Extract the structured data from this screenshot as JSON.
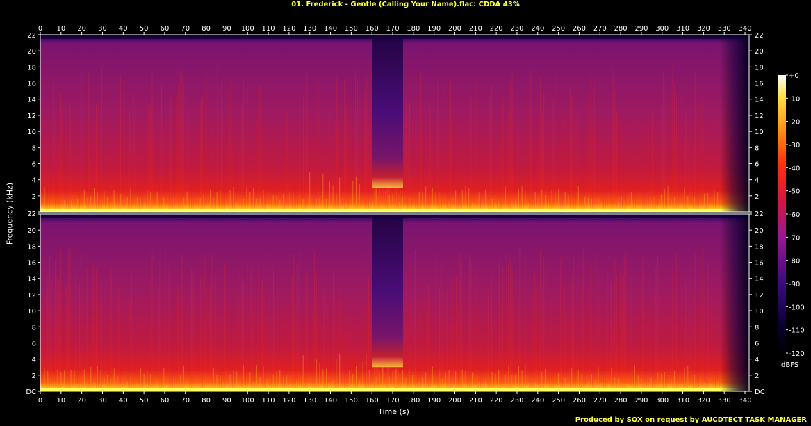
{
  "title": "01. Frederick - Gentle (Calling Your Name).flac: CDDA 43%",
  "footer": "Produced by SOX on request by AUCDTECT TASK MANAGER",
  "chart_data": {
    "type": "heatmap",
    "title": "01. Frederick - Gentle (Calling Your Name).flac: CDDA 43%",
    "xlabel": "Time (s)",
    "ylabel": "Frequency (kHz)",
    "channels": 2,
    "xlim": [
      0,
      342
    ],
    "ylim_khz": [
      0,
      22
    ],
    "x_ticks": [
      "0",
      "10",
      "20",
      "30",
      "40",
      "50",
      "60",
      "70",
      "80",
      "90",
      "100",
      "110",
      "120",
      "130",
      "140",
      "150",
      "160",
      "170",
      "180",
      "190",
      "200",
      "210",
      "220",
      "230",
      "240",
      "250",
      "260",
      "270",
      "280",
      "290",
      "300",
      "310",
      "320",
      "330",
      "340"
    ],
    "y_ticks": [
      "DC",
      "2",
      "4",
      "6",
      "8",
      "10",
      "12",
      "14",
      "16",
      "18",
      "20",
      "22"
    ],
    "colorbar": {
      "unit": "dBFS",
      "range": [
        -120,
        0
      ],
      "ticks": [
        "+0",
        "-10",
        "-20",
        "-30",
        "-40",
        "-50",
        "-60",
        "-70",
        "-80",
        "-90",
        "-100",
        "-110",
        "-120"
      ]
    },
    "features": {
      "quiet_section_s": [
        160,
        175
      ],
      "fade_out_start_s": 328,
      "cutoff_khz": 21.5
    }
  }
}
